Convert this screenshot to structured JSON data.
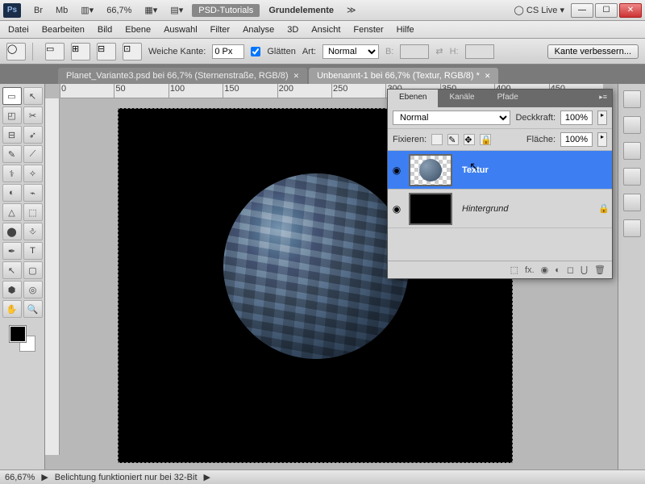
{
  "titlebar": {
    "ps": "Ps",
    "items": [
      "Br",
      "Mb"
    ],
    "zoom": "66,7%",
    "btn1": "PSD-Tutorials",
    "btn2": "Grundelemente",
    "cslive": "CS Live"
  },
  "menus": [
    "Datei",
    "Bearbeiten",
    "Bild",
    "Ebene",
    "Auswahl",
    "Filter",
    "Analyse",
    "3D",
    "Ansicht",
    "Fenster",
    "Hilfe"
  ],
  "options": {
    "weiche_kante": "Weiche Kante:",
    "weiche_kante_val": "0 Px",
    "glaetten": "Glätten",
    "art": "Art:",
    "art_val": "Normal",
    "b": "B:",
    "h": "H:",
    "kante_btn": "Kante verbessern..."
  },
  "doctabs": [
    {
      "label": "Planet_Variante3.psd bei 66,7% (Sternenstraße, RGB/8)",
      "active": false
    },
    {
      "label": "Unbenannt-1 bei 66,7% (Textur, RGB/8) *",
      "active": true
    }
  ],
  "ruler_ticks": [
    "0",
    "50",
    "100",
    "150",
    "200",
    "250",
    "300",
    "350",
    "400",
    "450"
  ],
  "layers_panel": {
    "tabs": [
      "Ebenen",
      "Kanäle",
      "Pfade"
    ],
    "blend_mode": "Normal",
    "opacity_lbl": "Deckkraft:",
    "opacity_val": "100%",
    "lock_lbl": "Fixieren:",
    "fill_lbl": "Fläche:",
    "fill_val": "100%",
    "layers": [
      {
        "name": "Textur",
        "selected": true,
        "visible": true,
        "locked": false,
        "thumb": "texture"
      },
      {
        "name": "Hintergrund",
        "selected": false,
        "visible": true,
        "locked": true,
        "thumb": "bg"
      }
    ],
    "footer_icons": [
      "⬚",
      "fx.",
      "◉",
      "◐",
      "◻",
      "⋃",
      "🗑"
    ]
  },
  "statusbar": {
    "zoom": "66,67%",
    "msg": "Belichtung funktioniert nur bei 32-Bit"
  },
  "tool_glyphs": [
    "▭",
    "↖",
    "◰",
    "✂",
    "⊟",
    "➶",
    "✎",
    "⟋",
    "⚕",
    "✧",
    "◐",
    "⌁",
    "△",
    "⬚",
    "⬤",
    "⎀",
    "✒",
    "T",
    "↖",
    "▢",
    "⬢",
    "◎",
    "✋",
    "🔍"
  ]
}
